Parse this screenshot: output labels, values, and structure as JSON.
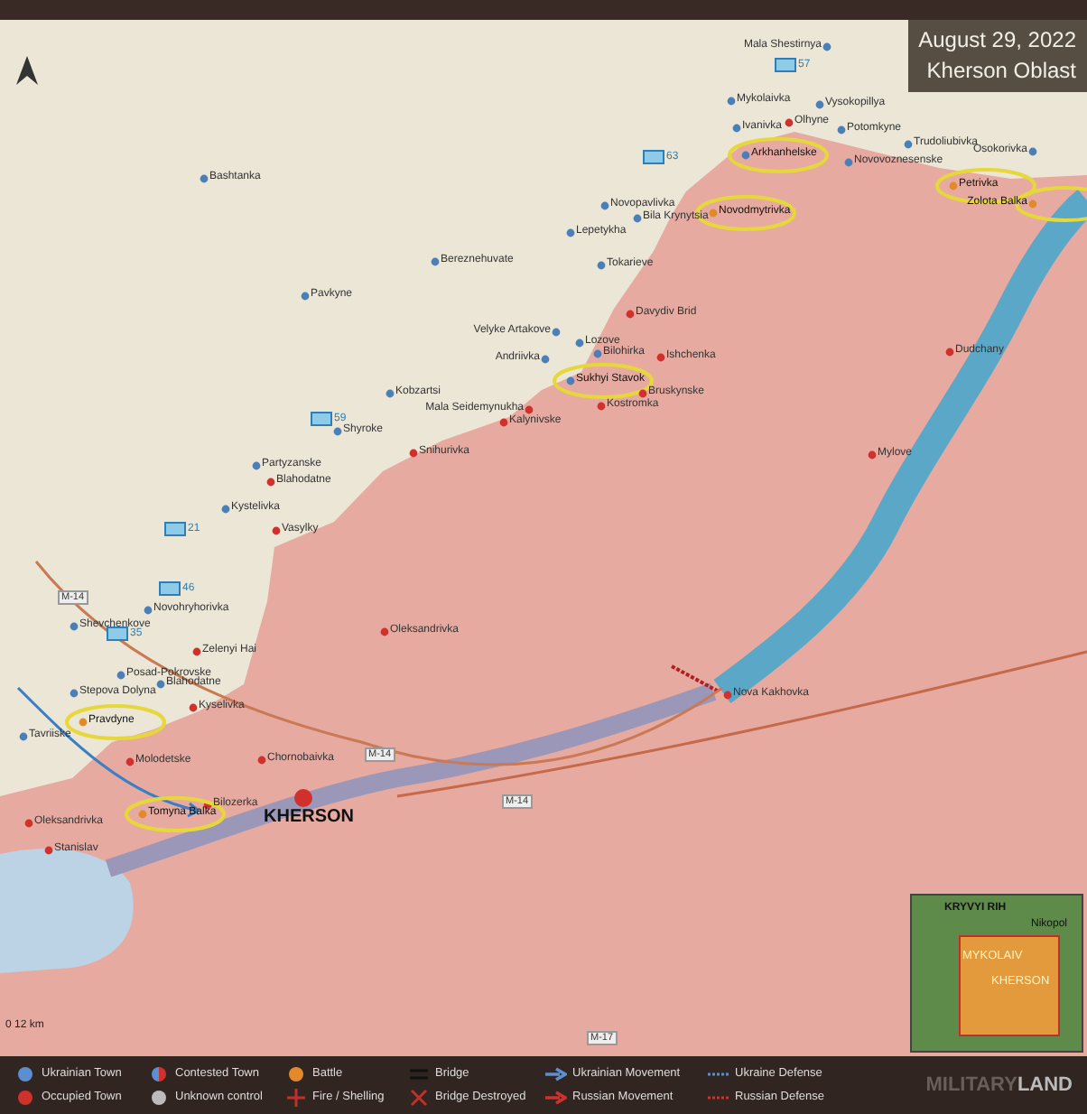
{
  "title": {
    "date": "August 29, 2022",
    "region": "Kherson Oblast"
  },
  "towns": [
    {
      "name": "Mala Shestirnya",
      "kind": "ukrainian",
      "highlighted": false
    },
    {
      "name": "Mykolaivka",
      "kind": "ukrainian",
      "highlighted": false
    },
    {
      "name": "Vysokopillya",
      "kind": "ukrainian",
      "highlighted": false
    },
    {
      "name": "Ivanivka",
      "kind": "ukrainian",
      "highlighted": false
    },
    {
      "name": "Olhyne",
      "kind": "occupied",
      "highlighted": false
    },
    {
      "name": "Potomkyne",
      "kind": "ukrainian",
      "highlighted": false
    },
    {
      "name": "Trudoliubivka",
      "kind": "ukrainian",
      "highlighted": false
    },
    {
      "name": "Arkhanhelske",
      "kind": "ukrainian",
      "highlighted": true
    },
    {
      "name": "Novovoznesenske",
      "kind": "ukrainian",
      "highlighted": false
    },
    {
      "name": "Osokorivka",
      "kind": "ukrainian",
      "highlighted": false
    },
    {
      "name": "Petrivka",
      "kind": "contested",
      "highlighted": true
    },
    {
      "name": "Zolota Balka",
      "kind": "contested",
      "highlighted": true
    },
    {
      "name": "Novopavlivka",
      "kind": "ukrainian",
      "highlighted": false
    },
    {
      "name": "Novodmytrivka",
      "kind": "contested",
      "highlighted": true
    },
    {
      "name": "Bila Krynytsia",
      "kind": "ukrainian",
      "highlighted": false
    },
    {
      "name": "Lepetykha",
      "kind": "ukrainian",
      "highlighted": false
    },
    {
      "name": "Tokarieve",
      "kind": "ukrainian",
      "highlighted": false
    },
    {
      "name": "Davydiv Brid",
      "kind": "occupied",
      "highlighted": false
    },
    {
      "name": "Velyke Artakove",
      "kind": "ukrainian",
      "highlighted": false
    },
    {
      "name": "Lozove",
      "kind": "ukrainian",
      "highlighted": false
    },
    {
      "name": "Bilohirka",
      "kind": "ukrainian",
      "highlighted": false
    },
    {
      "name": "Andriivka",
      "kind": "ukrainian",
      "highlighted": false
    },
    {
      "name": "Ishchenka",
      "kind": "occupied",
      "highlighted": false
    },
    {
      "name": "Sukhyi Stavok",
      "kind": "ukrainian",
      "highlighted": true
    },
    {
      "name": "Bruskynske",
      "kind": "occupied",
      "highlighted": false
    },
    {
      "name": "Kostromka",
      "kind": "occupied",
      "highlighted": false
    },
    {
      "name": "Dudchany",
      "kind": "occupied",
      "highlighted": false
    },
    {
      "name": "Mylove",
      "kind": "occupied",
      "highlighted": false
    },
    {
      "name": "Bashtanka",
      "kind": "ukrainian",
      "highlighted": false
    },
    {
      "name": "Bereznehuvate",
      "kind": "ukrainian",
      "highlighted": false
    },
    {
      "name": "Pavkyne",
      "kind": "ukrainian",
      "highlighted": false
    },
    {
      "name": "Kobzartsi",
      "kind": "ukrainian",
      "highlighted": false
    },
    {
      "name": "Mala Seidemynukha",
      "kind": "occupied",
      "highlighted": false
    },
    {
      "name": "Kalynivske",
      "kind": "occupied",
      "highlighted": false
    },
    {
      "name": "Shyroke",
      "kind": "ukrainian",
      "highlighted": false
    },
    {
      "name": "Snihurivka",
      "kind": "occupied",
      "highlighted": false
    },
    {
      "name": "Partyzanske",
      "kind": "ukrainian",
      "highlighted": false
    },
    {
      "name": "Blahodatne",
      "kind": "occupied",
      "highlighted": false
    },
    {
      "name": "Kystelivka",
      "kind": "ukrainian",
      "highlighted": false
    },
    {
      "name": "Vasylky",
      "kind": "occupied",
      "highlighted": false
    },
    {
      "name": "Shevchenkove",
      "kind": "ukrainian",
      "highlighted": false
    },
    {
      "name": "Novohryhorivka",
      "kind": "ukrainian",
      "highlighted": false
    },
    {
      "name": "Zelenyi Hai",
      "kind": "occupied",
      "highlighted": false
    },
    {
      "name": "Posad-Pokrovske",
      "kind": "ukrainian",
      "highlighted": false
    },
    {
      "name": "Blahodatne",
      "kind": "ukrainian",
      "highlighted": false
    },
    {
      "name": "Kyselivka",
      "kind": "occupied",
      "highlighted": false
    },
    {
      "name": "Stepova Dolyna",
      "kind": "ukrainian",
      "highlighted": false
    },
    {
      "name": "Tavriiske",
      "kind": "ukrainian",
      "highlighted": false
    },
    {
      "name": "Pravdyne",
      "kind": "contested",
      "highlighted": true
    },
    {
      "name": "Molodetske",
      "kind": "occupied",
      "highlighted": false
    },
    {
      "name": "Oleksandrivka",
      "kind": "occupied",
      "highlighted": false
    },
    {
      "name": "Chornobaivka",
      "kind": "occupied",
      "highlighted": false
    },
    {
      "name": "Bilozerka",
      "kind": "occupied",
      "highlighted": false
    },
    {
      "name": "Tomyna Balka",
      "kind": "contested",
      "highlighted": true
    },
    {
      "name": "Oleksandrivka",
      "kind": "occupied",
      "highlighted": false
    },
    {
      "name": "Stanislav",
      "kind": "occupied",
      "highlighted": false
    },
    {
      "name": "Nova Kakhovka",
      "kind": "occupied",
      "highlighted": false
    }
  ],
  "city": {
    "name": "KHERSON",
    "kind": "occupied"
  },
  "units": [
    {
      "label": "57"
    },
    {
      "label": "63"
    },
    {
      "label": "59"
    },
    {
      "label": "21"
    },
    {
      "label": "46"
    },
    {
      "label": "35"
    }
  ],
  "roads": [
    {
      "label": "M-14"
    },
    {
      "label": "M-14"
    },
    {
      "label": "M-14"
    },
    {
      "label": "M-17"
    }
  ],
  "scale": "0 12 km",
  "inset": {
    "labels": [
      {
        "name": "KRYVYI RIH",
        "kind": "city"
      },
      {
        "name": "Nikopol",
        "kind": "town"
      },
      {
        "name": "MYKOLAIV",
        "kind": "region"
      },
      {
        "name": "KHERSON",
        "kind": "region"
      }
    ]
  },
  "legend": [
    {
      "label": "Ukrainian Town",
      "kind": "ukrainian-town"
    },
    {
      "label": "Contested Town",
      "kind": "contested-town"
    },
    {
      "label": "Battle",
      "kind": "battle"
    },
    {
      "label": "Bridge",
      "kind": "bridge"
    },
    {
      "label": "Ukrainian Movement",
      "kind": "ukrainian-movement"
    },
    {
      "label": "Ukraine Defense",
      "kind": "ukrainian-defense"
    },
    {
      "label": "Occupied Town",
      "kind": "occupied-town"
    },
    {
      "label": "Unknown control",
      "kind": "unknown"
    },
    {
      "label": "Fire / Shelling",
      "kind": "fire"
    },
    {
      "label": "Bridge Destroyed",
      "kind": "bridge-destroyed"
    },
    {
      "label": "Russian Movement",
      "kind": "russian-movement"
    },
    {
      "label": "Russian Defense",
      "kind": "russian-defense"
    }
  ],
  "logo": {
    "prefix": "MILITARY",
    "suffix": "LAND"
  }
}
